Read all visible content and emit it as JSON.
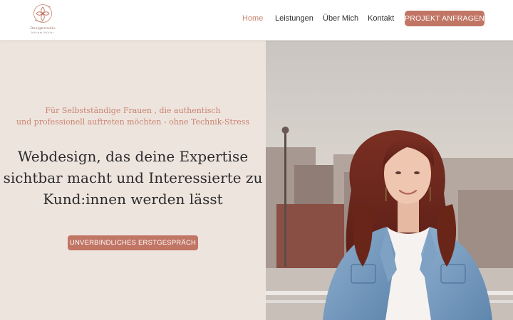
{
  "brand": {
    "name": "Designstudio",
    "owner": "Miriam Müller"
  },
  "nav": {
    "items": [
      {
        "label": "Home",
        "active": true
      },
      {
        "label": "Leistungen",
        "active": false
      },
      {
        "label": "Über Mich",
        "active": false
      },
      {
        "label": "Kontakt",
        "active": false
      }
    ],
    "cta_label": "PROJEKT ANFRAGEN"
  },
  "hero": {
    "subtitle_line1": "Für Selbstständige Frauen , die authentisch",
    "subtitle_line2": "und professionell auftreten möchten - ohne Technik-Stress",
    "headline_line1": "Webdesign, das deine Expertise",
    "headline_line2": "sichtbar macht und Interessierte zu",
    "headline_line3": "Kund:innen werden lässt",
    "cta_label": "UNVERBINDLICHES ERSTGESPRÄCH"
  },
  "colors": {
    "accent": "#c17564",
    "accent_text": "#c98470",
    "hero_background": "#eee4de",
    "text_dark": "#2b2b2b"
  },
  "icons": {
    "logo": "flower-icon"
  }
}
